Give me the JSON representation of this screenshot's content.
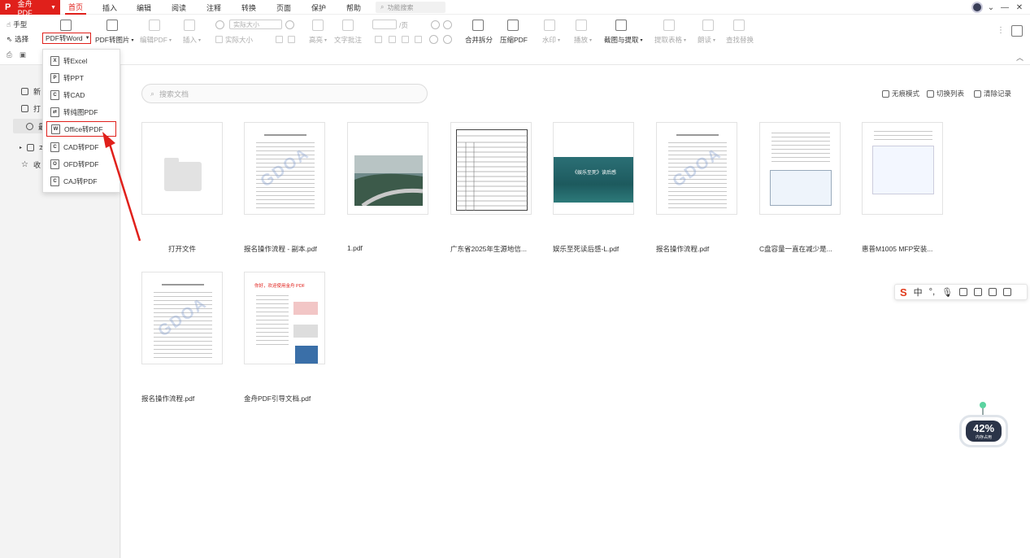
{
  "titlebar": {
    "app_name": "金舟PDF",
    "menus": [
      "首页",
      "插入",
      "编辑",
      "阅读",
      "注释",
      "转换",
      "页面",
      "保护",
      "帮助"
    ],
    "active_menu": "首页",
    "func_search_placeholder": "功能搜索"
  },
  "ribbon": {
    "hand": "手型",
    "select": "选择",
    "pdf_to_word": "PDF转Word",
    "pdf_to_image": "PDF转图片",
    "edit_pdf": "编辑PDF",
    "insert": "插入",
    "zoom_value": "实际大小",
    "actual_size": "实际大小",
    "highlight": "高亮",
    "text_annot": "文字批注",
    "page_unit": "/页",
    "merge_split": "合并拆分",
    "compress": "压缩PDF",
    "watermark": "水印",
    "play": "播放",
    "capture_extract": "截图与提取",
    "extract_table": "提取表格",
    "read_aloud": "朗读",
    "find_replace": "查找替换"
  },
  "dropdown": {
    "items": [
      "转Excel",
      "转PPT",
      "转CAD",
      "转纯图PDF",
      "Office转PDF",
      "CAD转PDF",
      "OFD转PDF",
      "CAJ转PDF"
    ],
    "icons": [
      "X",
      "P",
      "C",
      "⇄",
      "W",
      "C",
      "O",
      "C"
    ],
    "highlighted": "Office转PDF"
  },
  "sidebar": {
    "items": [
      "新",
      "打",
      "最",
      "本",
      "收"
    ]
  },
  "main": {
    "search_placeholder": "搜索文档",
    "actions": [
      "无痕模式",
      "切换列表",
      "清除记录"
    ],
    "files": [
      "打开文件",
      "报名操作流程 - 副本.pdf",
      "1.pdf",
      "广东省2025年生源地信...",
      "娱乐至死读后感-L.pdf",
      "报名操作流程.pdf",
      "C盘容量一直在减少是...",
      "惠普M1005 MFP安装...",
      "报名操作流程.pdf",
      "金舟PDF引导文档.pdf"
    ],
    "thumb_texts": {
      "entertainment_title": "《娱乐至死》读后感",
      "guide_title": "你好，欢迎使用金舟 PDF",
      "watermark": "GDOA"
    }
  },
  "ime": {
    "lang": "中"
  },
  "robot": {
    "percent": "42%",
    "label": "内存占用"
  },
  "colors": {
    "accent": "#e0201b"
  }
}
